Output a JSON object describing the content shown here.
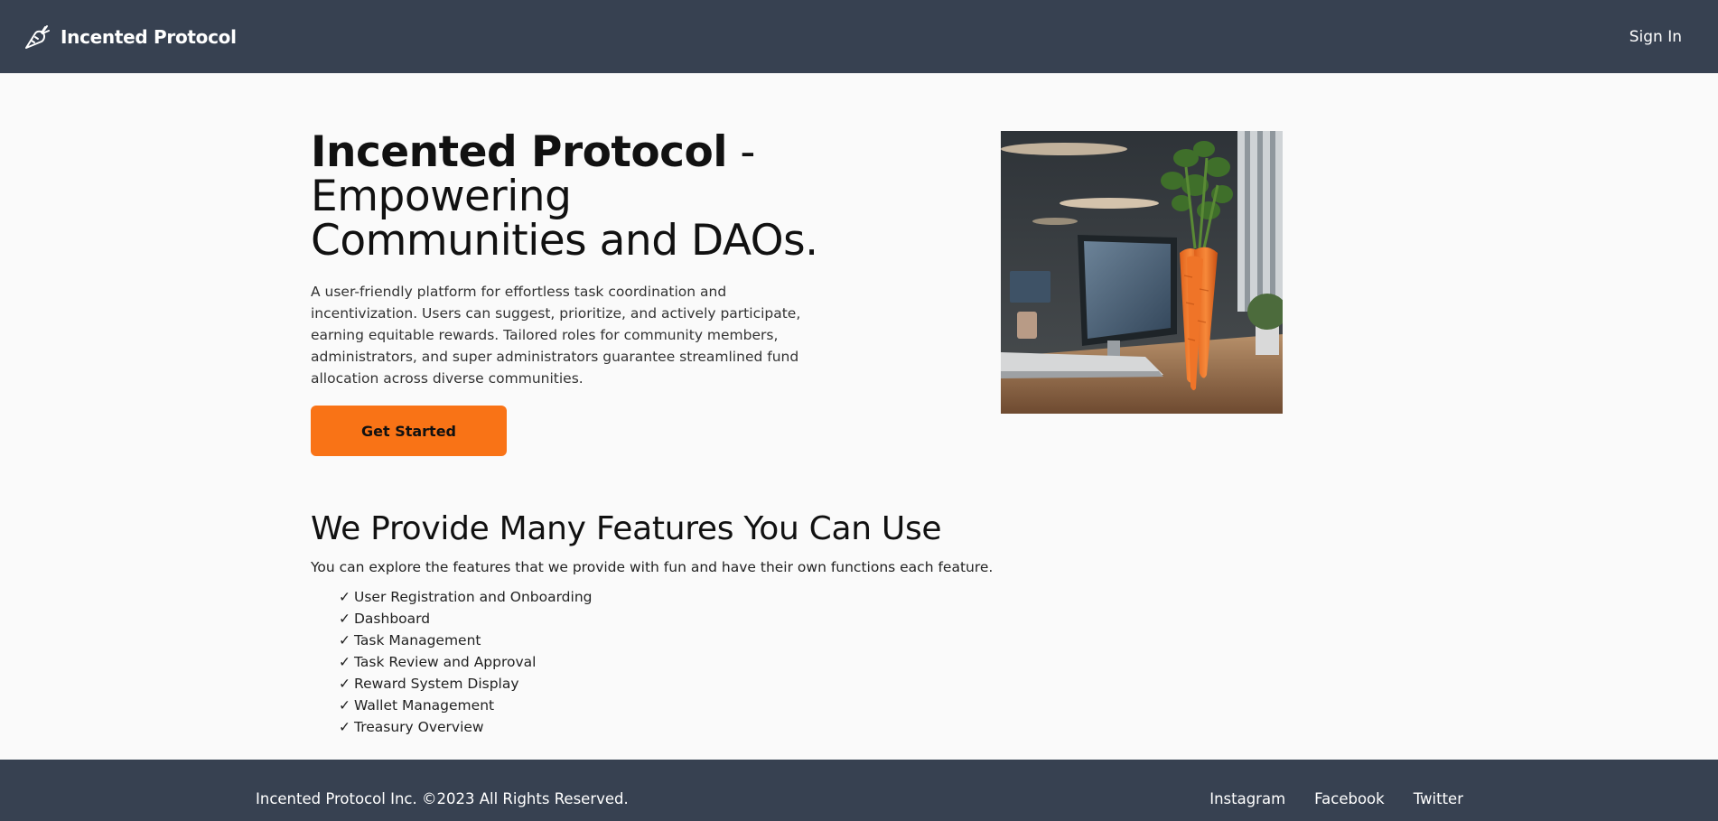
{
  "header": {
    "brand_name": "Incented Protocol",
    "sign_in": "Sign In"
  },
  "hero": {
    "title_bold": "Incented Protocol",
    "title_rest": " - Empowering Communities and DAOs.",
    "description": "A user-friendly platform for effortless task coordination and incentivization. Users can suggest, prioritize, and actively participate, earning equitable rewards. Tailored roles for community members, administrators, and super administrators guarantee streamlined fund allocation across diverse communities.",
    "cta_label": "Get Started"
  },
  "features": {
    "title": "We Provide Many Features You Can Use",
    "description": "You can explore the features that we provide with fun and have their own functions each feature.",
    "check_mark": "✓",
    "items": [
      "User Registration and Onboarding",
      "Dashboard",
      "Task Management",
      "Task Review and Approval",
      "Reward System Display",
      "Wallet Management",
      "Treasury Overview"
    ]
  },
  "footer": {
    "copyright": "Incented Protocol Inc. ©2023 All Rights Reserved.",
    "links": [
      "Instagram",
      "Facebook",
      "Twitter"
    ]
  },
  "colors": {
    "header_bg": "#374151",
    "accent": "#f97316",
    "page_bg": "#fafafa"
  },
  "icons": {
    "brand": "carrot-icon",
    "check": "check-icon"
  }
}
